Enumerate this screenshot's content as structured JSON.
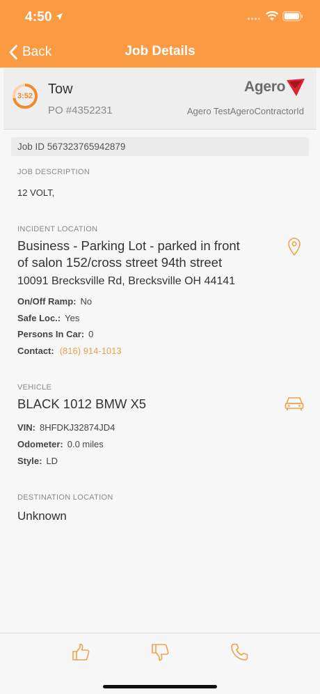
{
  "status_bar": {
    "time": "4:50"
  },
  "nav": {
    "back_label": "Back",
    "title": "Job Details"
  },
  "job": {
    "timer": "3:52",
    "timer_progress": 0.72,
    "service": "Tow",
    "po": "PO #4352231",
    "brand": "Agero",
    "contractor": "Agero TestAgeroContractorId",
    "job_id": "Job ID 567323765942879"
  },
  "job_description": {
    "label": "JOB DESCRIPTION",
    "text": "12 VOLT,"
  },
  "incident": {
    "label": "INCIDENT LOCATION",
    "title_line1": "Business - Parking Lot - parked in front",
    "title_line2": "of salon 152/cross street 94th street",
    "address": "10091 Brecksville Rd, Brecksville OH 44141",
    "ramp_key": "On/Off Ramp:",
    "ramp_val": "No",
    "safe_key": "Safe Loc.:",
    "safe_val": "Yes",
    "persons_key": "Persons In Car:",
    "persons_val": "0",
    "contact_key": "Contact:",
    "contact_val": "(816) 914-1013"
  },
  "vehicle": {
    "label": "VEHICLE",
    "title": "BLACK 1012 BMW X5",
    "vin_key": "VIN:",
    "vin_val": "8HFDKJ32874JD4",
    "odo_key": "Odometer:",
    "odo_val": "0.0 miles",
    "style_key": "Style:",
    "style_val": "LD"
  },
  "destination": {
    "label": "DESTINATION LOCATION",
    "text": "Unknown"
  },
  "toolbar": {
    "accept_icon": "thumbs-up-icon",
    "decline_icon": "thumbs-down-icon",
    "call_icon": "phone-icon"
  },
  "colors": {
    "accent": "#fa9a43",
    "link": "#f0a04b",
    "brand_red": "#e0242f"
  }
}
